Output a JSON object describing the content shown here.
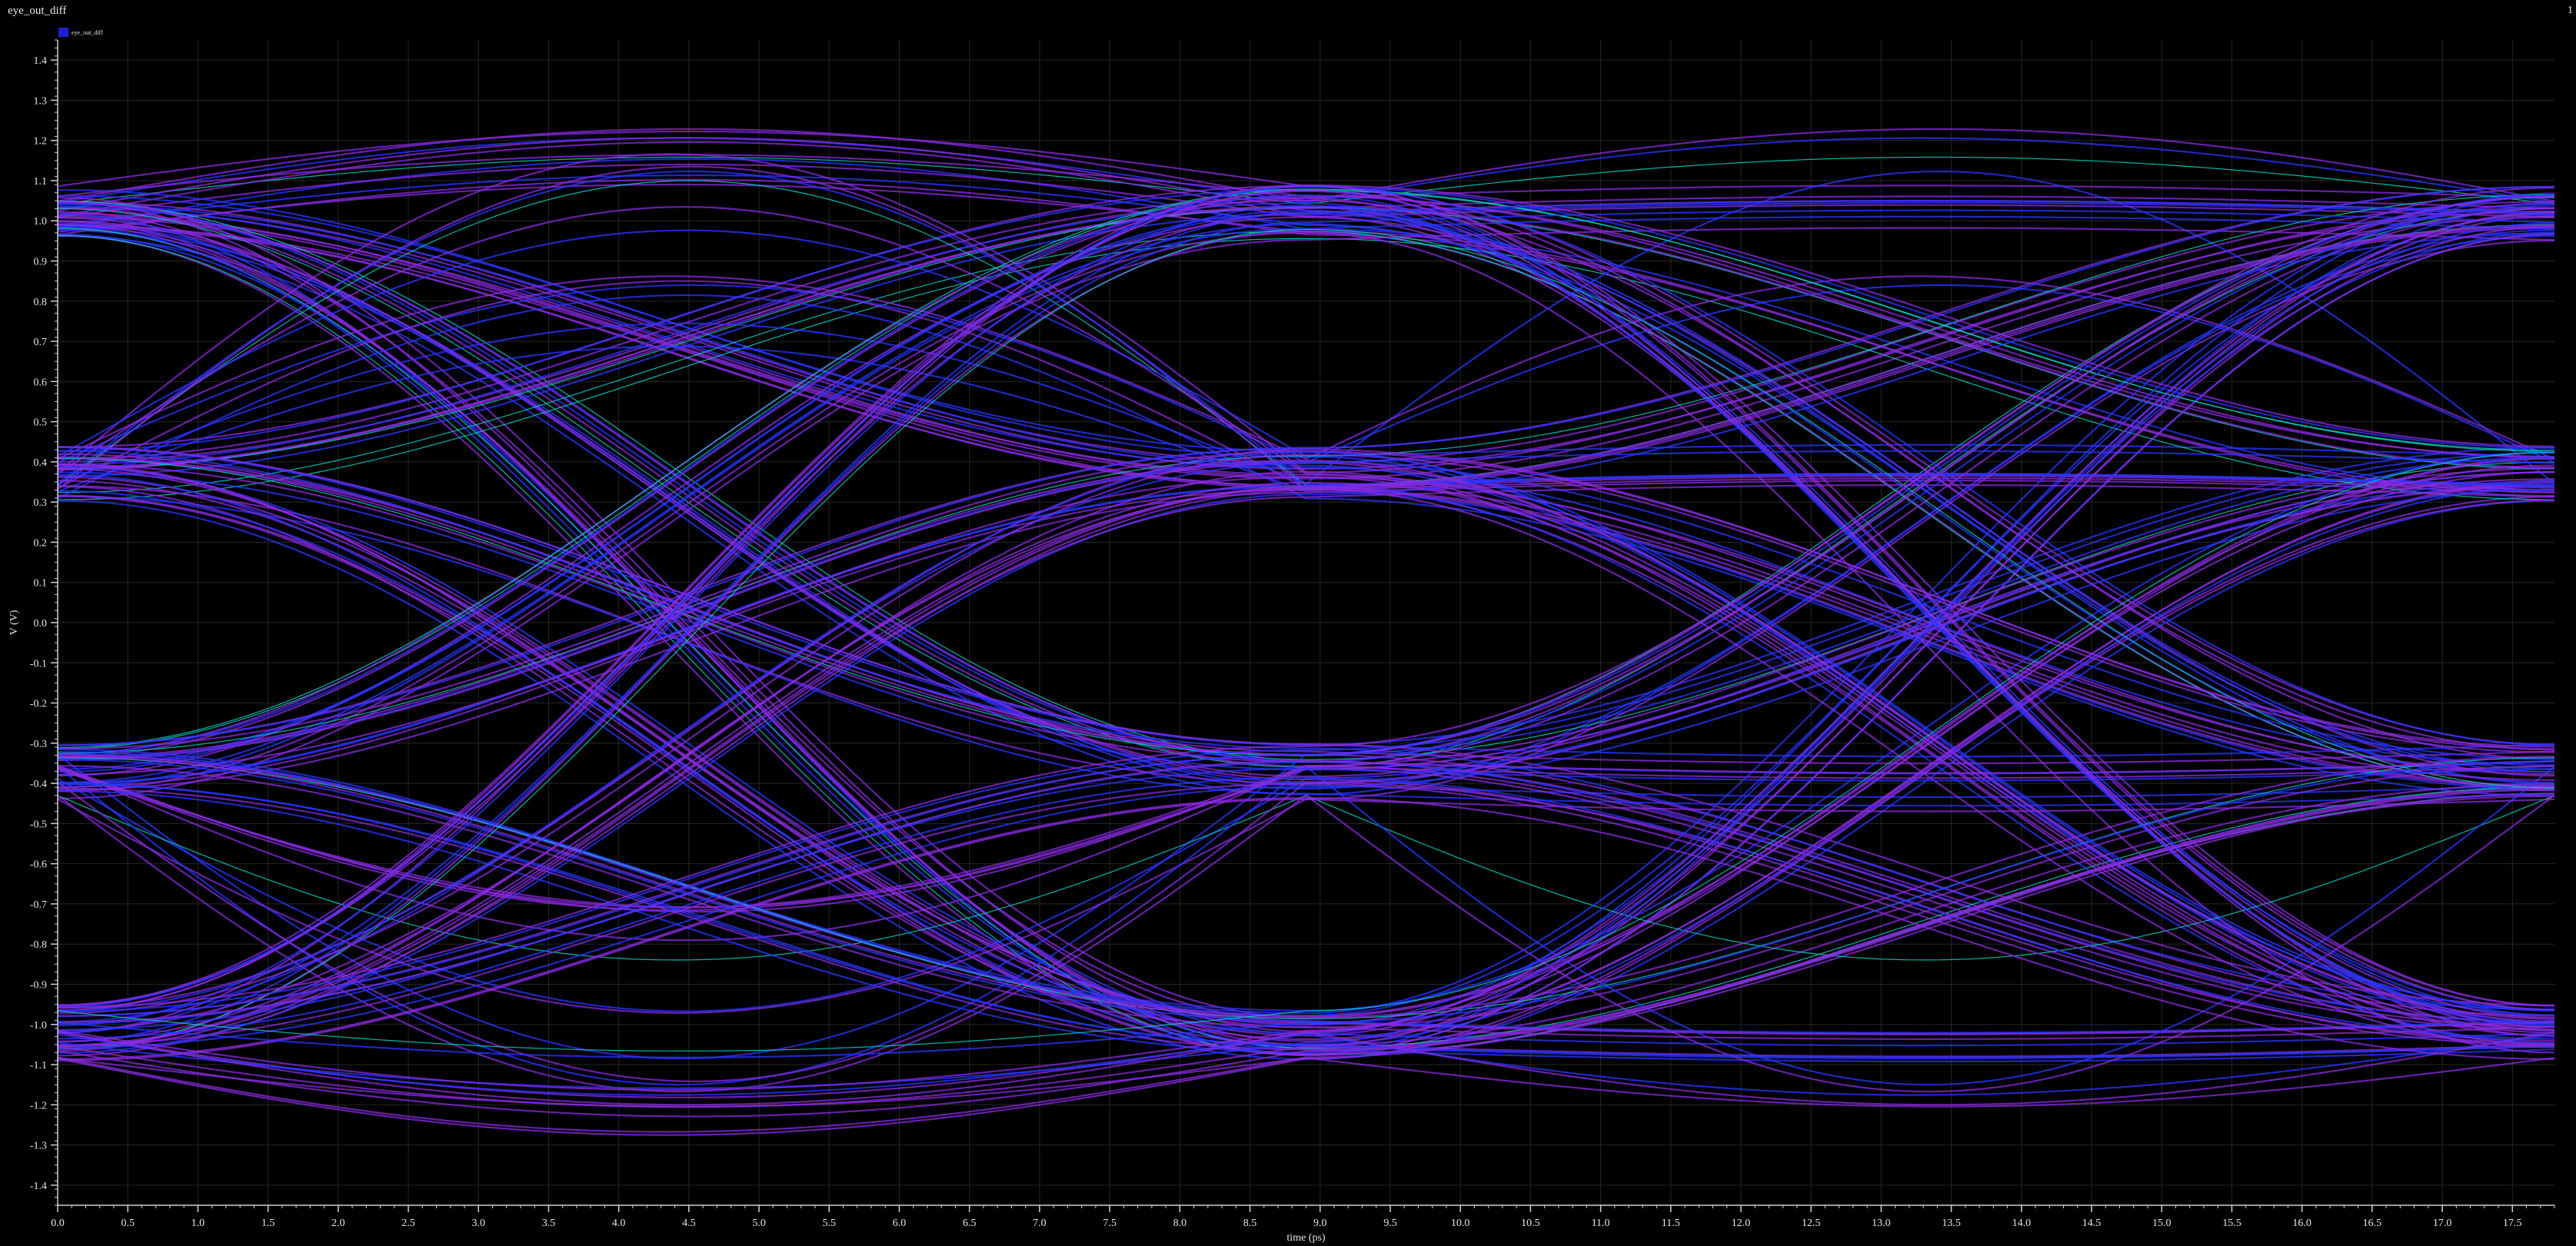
{
  "window": {
    "title": "eye_out_diff",
    "corner_mark": "1"
  },
  "legend": {
    "label": "eye_out_diff",
    "color": "#1f1fd6"
  },
  "colors": {
    "background": "#000000",
    "grid": "#262626",
    "axis": "#cfcfcf",
    "trace_outer": "#8a2be2",
    "trace_inner": "#2a35ff",
    "trace_dense": "#00d7c8"
  },
  "chart_data": {
    "type": "line",
    "subtype": "eye-diagram",
    "title": "eye_out_diff",
    "xlabel": "time (ps)",
    "ylabel": "V (V)",
    "xlim": [
      0.0,
      17.8
    ],
    "ylim": [
      -1.45,
      1.45
    ],
    "grid": true,
    "legend_position": "top-left",
    "series": [
      {
        "name": "eye_out_diff",
        "color": "#1f1fd6"
      }
    ],
    "levels": [
      1.02,
      0.37,
      -0.37,
      -1.02
    ],
    "level_spread": 0.07,
    "overshoot_peak": 1.22,
    "crossing_times": [
      0.0,
      8.9,
      17.8
    ],
    "x_ticks": [
      "0.0",
      "0.5",
      "1.0",
      "1.5",
      "2.0",
      "2.5",
      "3.0",
      "3.5",
      "4.0",
      "4.5",
      "5.0",
      "5.5",
      "6.0",
      "6.5",
      "7.0",
      "7.5",
      "8.0",
      "8.5",
      "9.0",
      "9.5",
      "10.0",
      "10.5",
      "11.0",
      "11.5",
      "12.0",
      "12.5",
      "13.0",
      "13.5",
      "14.0",
      "14.5",
      "15.0",
      "15.5",
      "16.0",
      "16.5",
      "17.0",
      "17.5"
    ],
    "y_ticks": [
      "1.4",
      "1.3",
      "1.2",
      "1.1",
      "1.0",
      "0.9",
      "0.8",
      "0.7",
      "0.6",
      "0.5",
      "0.4",
      "0.3",
      "0.2",
      "0.1",
      "0.0",
      "-0.1",
      "-0.2",
      "-0.3",
      "-0.4",
      "-0.5",
      "-0.6",
      "-0.7",
      "-0.8",
      "-0.9",
      "-1.0",
      "-1.1",
      "-1.2",
      "-1.3",
      "-1.4"
    ]
  }
}
